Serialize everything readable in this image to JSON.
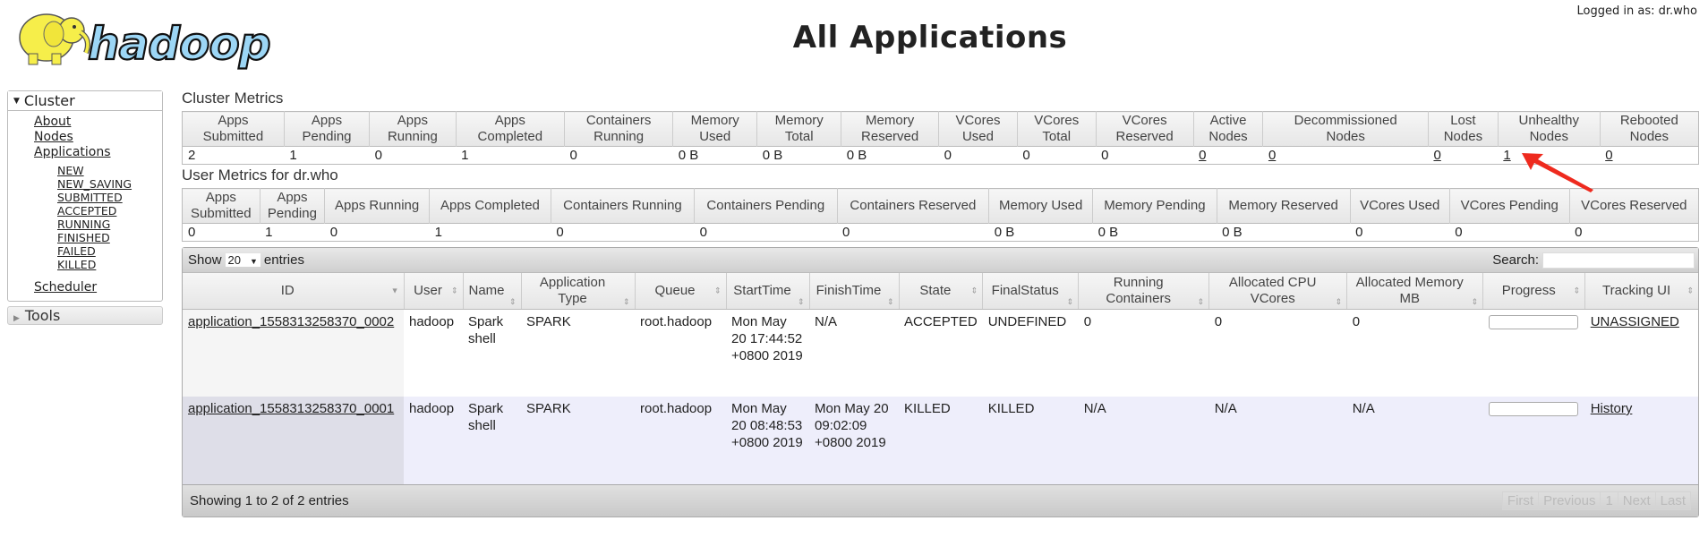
{
  "header": {
    "logo_text": "hadoop",
    "title": "All Applications",
    "logged_in": "Logged in as: dr.who"
  },
  "nav": {
    "cluster_label": "Cluster",
    "items": [
      "About",
      "Nodes",
      "Applications"
    ],
    "app_states": [
      "NEW",
      "NEW_SAVING",
      "SUBMITTED",
      "ACCEPTED",
      "RUNNING",
      "FINISHED",
      "FAILED",
      "KILLED"
    ],
    "scheduler": "Scheduler",
    "tools_label": "Tools"
  },
  "cluster_metrics": {
    "title": "Cluster Metrics",
    "headers": [
      [
        "Apps",
        "Submitted"
      ],
      [
        "Apps",
        "Pending"
      ],
      [
        "Apps",
        "Running"
      ],
      [
        "Apps",
        "Completed"
      ],
      [
        "Containers",
        "Running"
      ],
      [
        "Memory",
        "Used"
      ],
      [
        "Memory",
        "Total"
      ],
      [
        "Memory",
        "Reserved"
      ],
      [
        "VCores",
        "Used"
      ],
      [
        "VCores",
        "Total"
      ],
      [
        "VCores",
        "Reserved"
      ],
      [
        "Active",
        "Nodes"
      ],
      [
        "Decommissioned",
        "Nodes"
      ],
      [
        "Lost",
        "Nodes"
      ],
      [
        "Unhealthy",
        "Nodes"
      ],
      [
        "Rebooted",
        "Nodes"
      ]
    ],
    "values": [
      "2",
      "1",
      "0",
      "1",
      "0",
      "0 B",
      "0 B",
      "0 B",
      "0",
      "0",
      "0",
      "0",
      "0",
      "0",
      "1",
      "0"
    ],
    "linked": [
      false,
      false,
      false,
      false,
      false,
      false,
      false,
      false,
      false,
      false,
      false,
      true,
      true,
      true,
      true,
      true
    ]
  },
  "user_metrics": {
    "title": "User Metrics for dr.who",
    "headers": [
      [
        "Apps",
        "Submitted"
      ],
      [
        "Apps",
        "Pending"
      ],
      [
        "Apps Running"
      ],
      [
        "Apps Completed"
      ],
      [
        "Containers Running"
      ],
      [
        "Containers Pending"
      ],
      [
        "Containers Reserved"
      ],
      [
        "Memory Used"
      ],
      [
        "Memory Pending"
      ],
      [
        "Memory Reserved"
      ],
      [
        "VCores Used"
      ],
      [
        "VCores Pending"
      ],
      [
        "VCores Reserved"
      ]
    ],
    "values": [
      "0",
      "1",
      "0",
      "1",
      "0",
      "0",
      "0",
      "0 B",
      "0 B",
      "0 B",
      "0",
      "0",
      "0"
    ]
  },
  "apps_table": {
    "show_label": "Show",
    "page_size": "20",
    "entries_label": "entries",
    "search_label": "Search:",
    "search_value": "",
    "columns": [
      "ID",
      "User",
      "Name",
      "Application Type",
      "Queue",
      "StartTime",
      "FinishTime",
      "State",
      "FinalStatus",
      "Running Containers",
      "Allocated CPU VCores",
      "Allocated Memory MB",
      "Progress",
      "Tracking UI"
    ],
    "rows": [
      {
        "id": "application_1558313258370_0002",
        "user": "hadoop",
        "name": "Spark shell",
        "type": "SPARK",
        "queue": "root.hadoop",
        "start": "Mon May 20 17:44:52 +0800 2019",
        "finish": "N/A",
        "state": "ACCEPTED",
        "final": "UNDEFINED",
        "containers": "0",
        "vcores": "0",
        "memory": "0",
        "progress": 0,
        "tracking": "UNASSIGNED"
      },
      {
        "id": "application_1558313258370_0001",
        "user": "hadoop",
        "name": "Spark shell",
        "type": "SPARK",
        "queue": "root.hadoop",
        "start": "Mon May 20 08:48:53 +0800 2019",
        "finish": "Mon May 20 09:02:09 +0800 2019",
        "state": "KILLED",
        "final": "KILLED",
        "containers": "N/A",
        "vcores": "N/A",
        "memory": "N/A",
        "progress": 0,
        "tracking": "History"
      }
    ],
    "info": "Showing 1 to 2 of 2 entries",
    "pager": [
      "First",
      "Previous",
      "1",
      "Next",
      "Last"
    ]
  },
  "annotation": {
    "arrow_color": "#ee2a1e"
  }
}
